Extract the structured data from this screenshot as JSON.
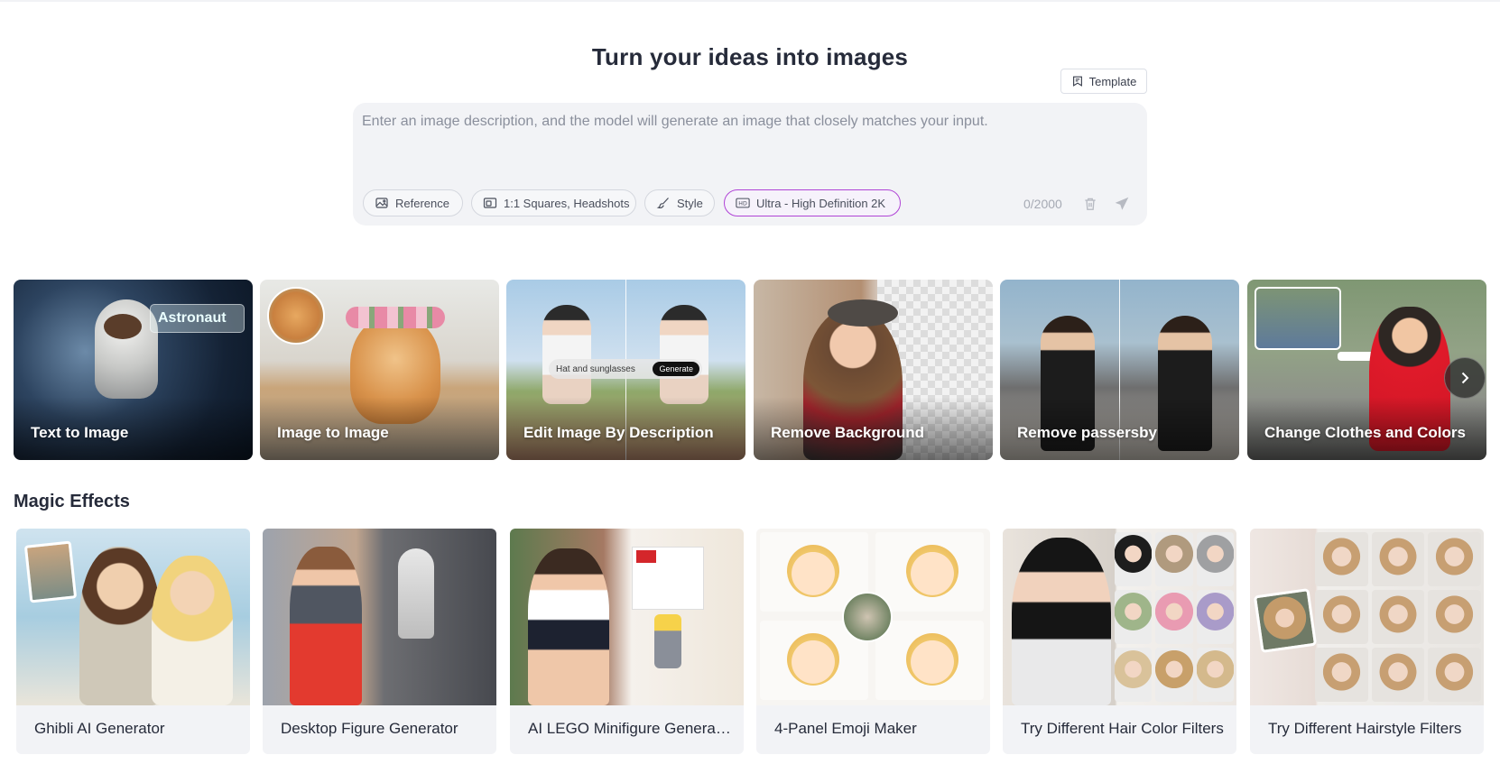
{
  "hero": {
    "title": "Turn your ideas into images",
    "template_label": "Template"
  },
  "prompt": {
    "placeholder": "Enter an image description, and the model will generate an image that closely matches your input.",
    "value": "",
    "char_count": "0/2000",
    "max_chars": 2000
  },
  "options": {
    "reference": "Reference",
    "ratio": "1:1 Squares, Headshots",
    "style": "Style",
    "quality": "Ultra - High Definition 2K",
    "quality_badge": "HD"
  },
  "tools": [
    {
      "label": "Text to Image",
      "overlay": "Astronaut"
    },
    {
      "label": "Image to Image"
    },
    {
      "label": "Edit Image By Description",
      "overlay": "Hat and sunglasses",
      "overlay_button": "Generate"
    },
    {
      "label": "Remove Background"
    },
    {
      "label": "Remove passersby"
    },
    {
      "label": "Change Clothes and Colors"
    }
  ],
  "magic_effects": {
    "title": "Magic Effects",
    "items": [
      {
        "label": "Ghibli AI Generator"
      },
      {
        "label": "Desktop Figure Generator"
      },
      {
        "label": "AI LEGO Minifigure Generator"
      },
      {
        "label": "4-Panel Emoji Maker"
      },
      {
        "label": "Try Different Hair Color Filters"
      },
      {
        "label": "Try Different Hairstyle Filters"
      }
    ]
  },
  "colors": {
    "accent_hd": "#b044d6",
    "title_text": "#262b3a",
    "prompt_bg": "#f2f3f6"
  },
  "icons": {
    "template": "template-icon",
    "reference": "image-icon",
    "ratio": "aspect-ratio-icon",
    "style": "brush-icon",
    "trash": "trash-icon",
    "send": "send-icon",
    "next": "chevron-right-icon"
  }
}
